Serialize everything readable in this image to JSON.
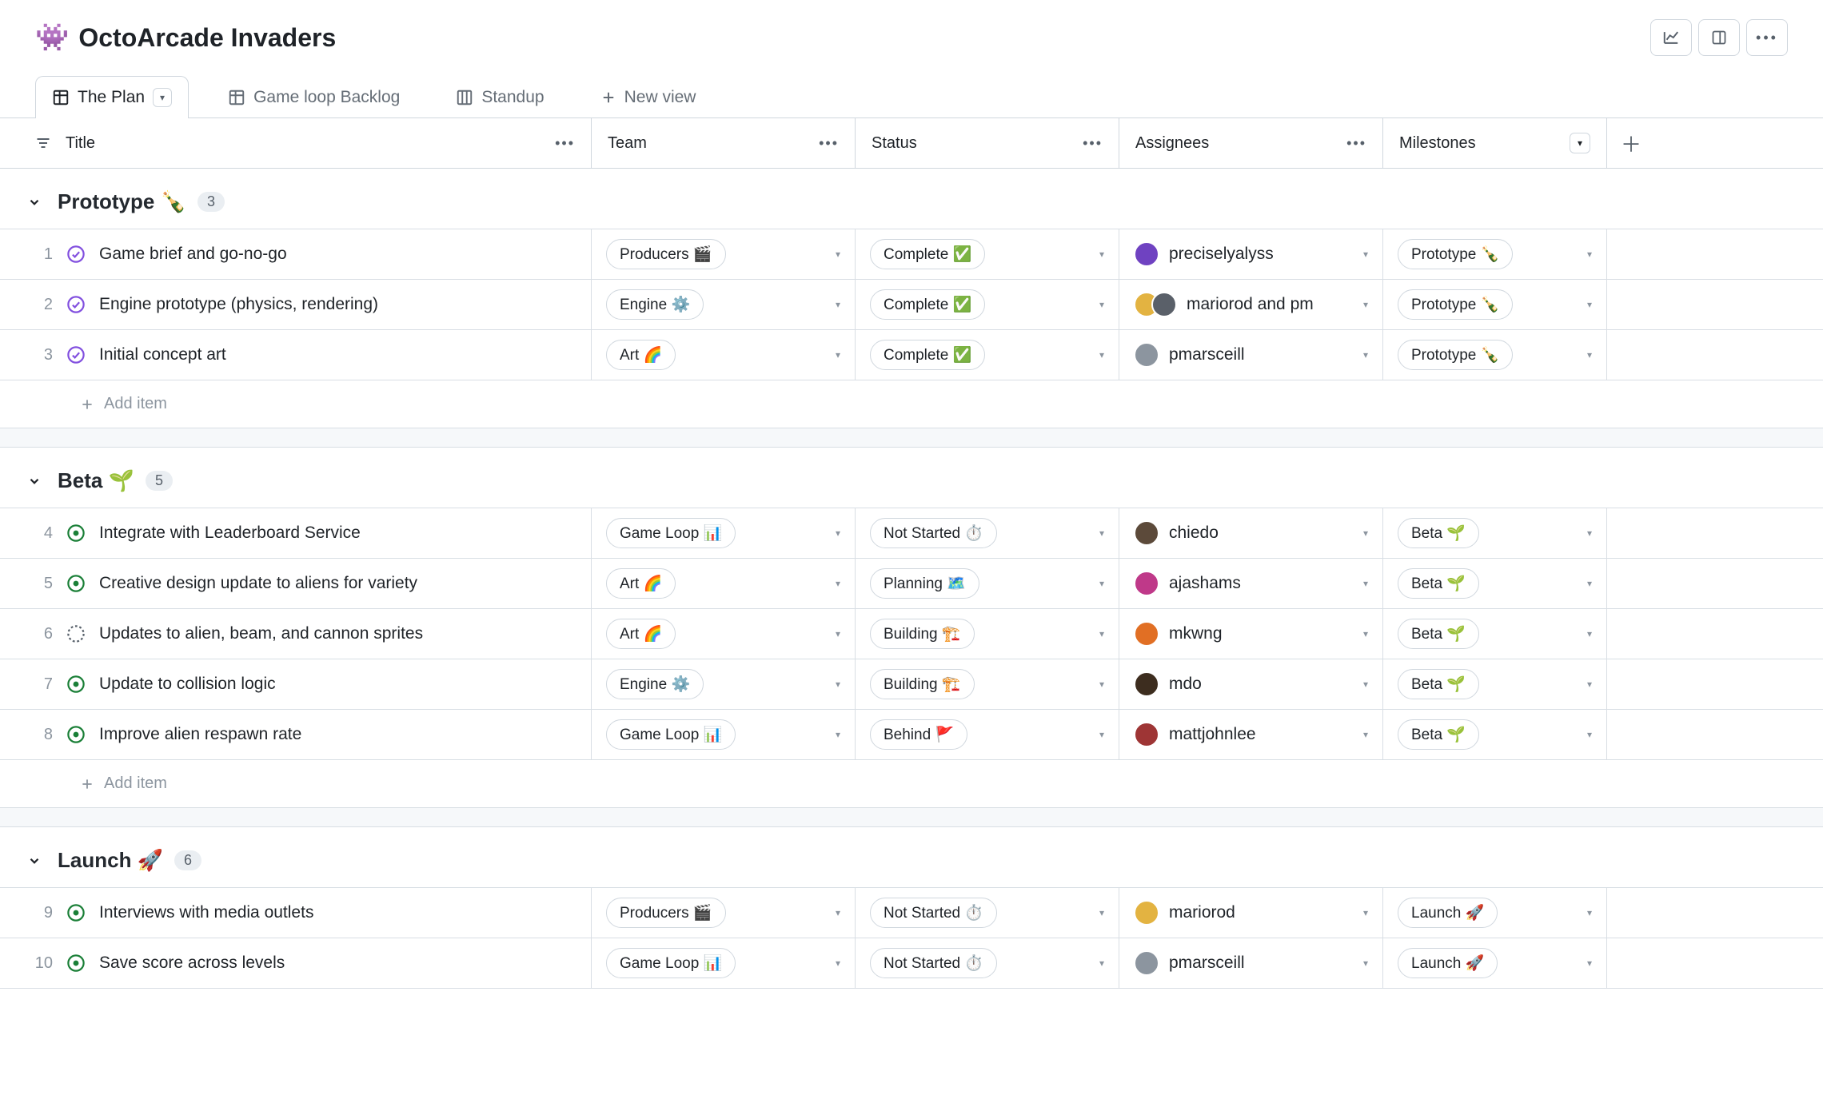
{
  "project": {
    "emoji": "👾",
    "title": "OctoArcade Invaders"
  },
  "tabs": [
    {
      "id": "plan",
      "label": "The Plan",
      "active": true,
      "icon": "table"
    },
    {
      "id": "backlog",
      "label": "Game loop Backlog",
      "active": false,
      "icon": "table"
    },
    {
      "id": "standup",
      "label": "Standup",
      "active": false,
      "icon": "board"
    },
    {
      "id": "new",
      "label": "New view",
      "active": false,
      "icon": "plus"
    }
  ],
  "columns": {
    "title": "Title",
    "team": "Team",
    "status": "Status",
    "assignees": "Assignees",
    "milestones": "Milestones"
  },
  "add_item_label": "Add item",
  "groups": [
    {
      "name": "Prototype",
      "emoji": "🍾",
      "count": 3,
      "rows": [
        {
          "num": 1,
          "state": "closed",
          "title": "Game brief and go-no-go",
          "team": "Producers 🎬",
          "status": "Complete ✅",
          "assignees": "preciselyalyss",
          "avatars": 1,
          "milestone": "Prototype 🍾"
        },
        {
          "num": 2,
          "state": "closed",
          "title": "Engine prototype (physics, rendering)",
          "team": "Engine ⚙️",
          "status": "Complete ✅",
          "assignees": "mariorod and pm",
          "avatars": 2,
          "milestone": "Prototype 🍾"
        },
        {
          "num": 3,
          "state": "closed",
          "title": "Initial concept art",
          "team": "Art 🌈",
          "status": "Complete ✅",
          "assignees": "pmarsceill",
          "avatars": 1,
          "milestone": "Prototype 🍾"
        }
      ]
    },
    {
      "name": "Beta",
      "emoji": "🌱",
      "count": 5,
      "rows": [
        {
          "num": 4,
          "state": "open",
          "title": "Integrate with Leaderboard Service",
          "team": "Game Loop 📊",
          "status": "Not Started ⏱️",
          "assignees": "chiedo",
          "avatars": 1,
          "milestone": "Beta 🌱"
        },
        {
          "num": 5,
          "state": "open",
          "title": "Creative design update to aliens for variety",
          "team": "Art 🌈",
          "status": "Planning 🗺️",
          "assignees": "ajashams",
          "avatars": 1,
          "milestone": "Beta 🌱"
        },
        {
          "num": 6,
          "state": "draft",
          "title": "Updates to alien, beam, and cannon sprites",
          "team": "Art 🌈",
          "status": "Building 🏗️",
          "assignees": "mkwng",
          "avatars": 1,
          "milestone": "Beta 🌱"
        },
        {
          "num": 7,
          "state": "open",
          "title": "Update to collision logic",
          "team": "Engine ⚙️",
          "status": "Building 🏗️",
          "assignees": "mdo",
          "avatars": 1,
          "milestone": "Beta 🌱"
        },
        {
          "num": 8,
          "state": "open",
          "title": "Improve alien respawn rate",
          "team": "Game Loop 📊",
          "status": "Behind 🚩",
          "assignees": "mattjohnlee",
          "avatars": 1,
          "milestone": "Beta 🌱"
        }
      ]
    },
    {
      "name": "Launch",
      "emoji": "🚀",
      "count": 6,
      "rows": [
        {
          "num": 9,
          "state": "open",
          "title": "Interviews with media outlets",
          "team": "Producers 🎬",
          "status": "Not Started ⏱️",
          "assignees": "mariorod",
          "avatars": 1,
          "milestone": "Launch 🚀"
        },
        {
          "num": 10,
          "state": "open",
          "title": "Save score across levels",
          "team": "Game Loop 📊",
          "status": "Not Started ⏱️",
          "assignees": "pmarsceill",
          "avatars": 1,
          "milestone": "Launch 🚀"
        }
      ]
    }
  ],
  "avatar_colors": {
    "preciselyalyss": "#6f42c1",
    "mariorod": "#e3b341",
    "pm": "#5a6069",
    "pmarsceill": "#8c959f",
    "chiedo": "#5c4a3a",
    "ajashams": "#bf3989",
    "mkwng": "#e16f24",
    "mdo": "#3d2d1f",
    "mattjohnlee": "#9e3535"
  }
}
